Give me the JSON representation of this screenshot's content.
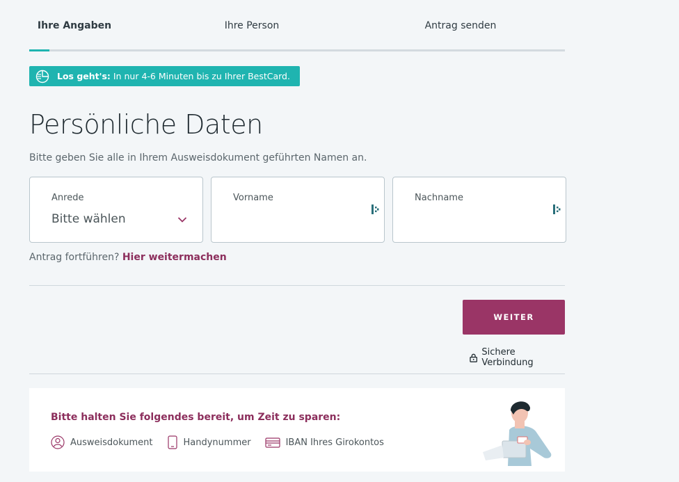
{
  "steps": [
    "Ihre Angaben",
    "Ihre Person",
    "Antrag senden"
  ],
  "banner": {
    "bold": "Los geht's:",
    "text": "In nur 4-6 Minuten bis zu Ihrer BestCard."
  },
  "title": "Persönliche Daten",
  "subtitle": "Bitte geben Sie alle in Ihrem Ausweisdokument geführten Namen an.",
  "fields": {
    "anrede": {
      "label": "Anrede",
      "value": "Bitte wählen"
    },
    "vorname": {
      "label": "Vorname",
      "value": ""
    },
    "nachname": {
      "label": "Nachname",
      "value": ""
    }
  },
  "continue": {
    "text": "Antrag fortführen?",
    "link": "Hier weitermachen"
  },
  "button": {
    "label": "WEITER"
  },
  "secure": "Sichere Verbindung",
  "card": {
    "heading": "Bitte halten Sie folgendes bereit, um Zeit zu sparen:",
    "items": [
      "Ausweisdokument",
      "Handynummer",
      "IBAN Ihres Girokontos"
    ]
  },
  "colors": {
    "accent": "#1fb4b0",
    "brand": "#9a3566",
    "link": "#8c2e5c"
  },
  "icons": [
    "timer-icon",
    "chevron-down-icon",
    "password-manager-icon",
    "lock-icon",
    "id-card-icon",
    "phone-icon",
    "bank-card-icon"
  ]
}
